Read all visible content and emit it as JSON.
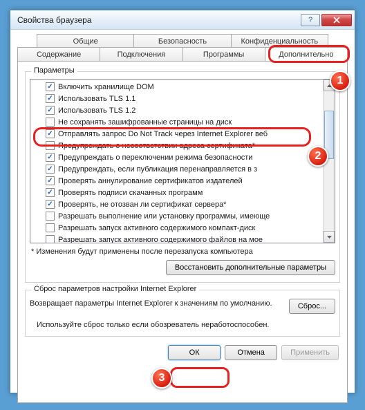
{
  "window": {
    "title": "Свойства браузера"
  },
  "tabs": {
    "row1": [
      "Общие",
      "Безопасность",
      "Конфиденциальность"
    ],
    "row2": [
      "Содержание",
      "Подключения",
      "Программы",
      "Дополнительно"
    ],
    "active": "Дополнительно"
  },
  "group": {
    "label": "Параметры"
  },
  "items": [
    {
      "checked": true,
      "label": "Включить хранилище DOM"
    },
    {
      "checked": true,
      "label": "Использовать TLS 1.1"
    },
    {
      "checked": true,
      "label": "Использовать TLS 1.2"
    },
    {
      "checked": false,
      "label": "Не сохранять зашифрованные страницы на диск"
    },
    {
      "checked": true,
      "label": "Отправлять запрос Do Not Track через Internet Explorer веб"
    },
    {
      "checked": false,
      "label": "Предупреждать о несоответствии адреса сертификата*"
    },
    {
      "checked": true,
      "label": "Предупреждать о переключении режима безопасности"
    },
    {
      "checked": true,
      "label": "Предупреждать, если публикация перенаправляется в з"
    },
    {
      "checked": true,
      "label": "Проверять аннулирование сертификатов издателей"
    },
    {
      "checked": true,
      "label": "Проверять подписи скачанных программ"
    },
    {
      "checked": true,
      "label": "Проверять, не отозван ли сертификат сервера*"
    },
    {
      "checked": false,
      "label": "Разрешать выполнение или установку программы, имеюще"
    },
    {
      "checked": false,
      "label": "Разрешать запуск активного содержимого компакт-диск"
    },
    {
      "checked": false,
      "label": "Разрешать запуск активного содержимого файлов на мое"
    }
  ],
  "note": "* Изменения будут применены после перезапуска компьютера",
  "restore_btn": "Восстановить дополнительные параметры",
  "reset": {
    "group_label": "Сброс параметров настройки Internet Explorer",
    "text": "Возвращает параметры Internet Explorer к значениям по умолчанию.",
    "btn": "Сброс...",
    "footnote": "Используйте сброс только если обозреватель неработоспособен."
  },
  "dialog": {
    "ok": "ОК",
    "cancel": "Отмена",
    "apply": "Применить"
  },
  "badges": [
    "1",
    "2",
    "3"
  ]
}
